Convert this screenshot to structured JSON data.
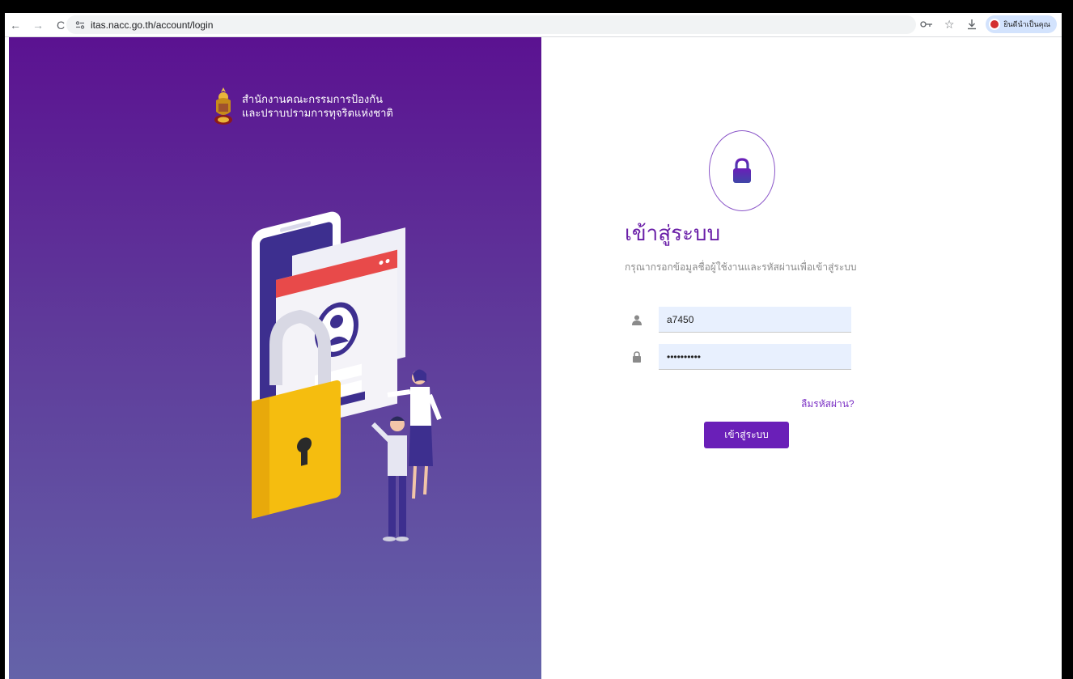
{
  "browser": {
    "url": "itas.nacc.go.th/account/login",
    "profile_label": "ยินดีนำเป็นคุณ"
  },
  "left_panel": {
    "org_line1": "สำนักงานคณะกรรมการป้องกัน",
    "org_line2": "และปราบปรามการทุจริตแห่งชาติ"
  },
  "login": {
    "title": "เข้าสู่ระบบ",
    "subtitle": "กรุณากรอกข้อมูลชื่อผู้ใช้งานและรหัสผ่านเพื่อเข้าสู่ระบบ",
    "username_value": "a7450",
    "password_value": "••••••••••",
    "forgot_label": "ลืมรหัสผ่าน?",
    "submit_label": "เข้าสู่ระบบ"
  },
  "colors": {
    "accent": "#6a1fb8",
    "gradient_top": "#5b1291",
    "gradient_bottom": "#6463a9"
  }
}
